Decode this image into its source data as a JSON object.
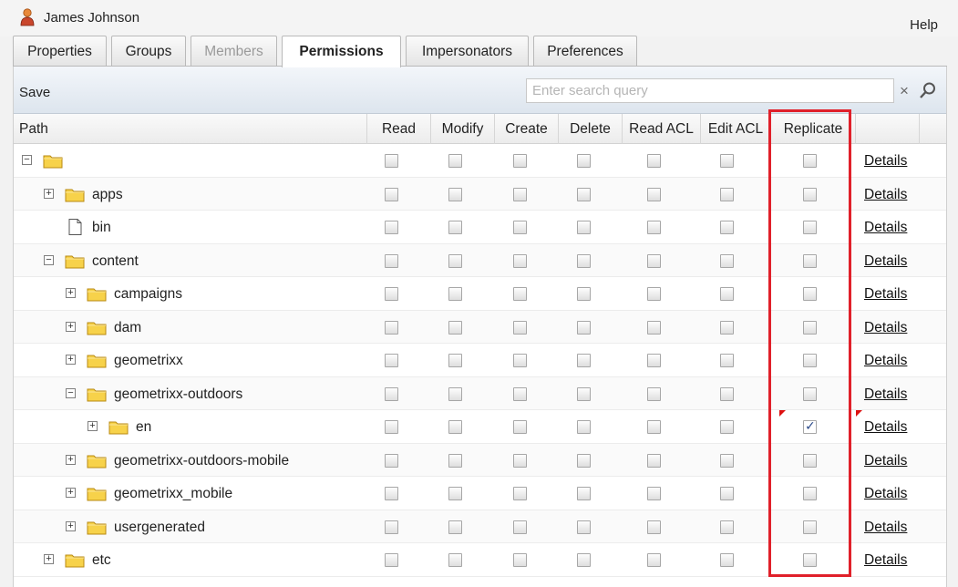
{
  "header": {
    "user_name": "James Johnson",
    "help_label": "Help"
  },
  "tabs": [
    {
      "label": "Properties",
      "state": "normal"
    },
    {
      "label": "Groups",
      "state": "normal"
    },
    {
      "label": "Members",
      "state": "disabled"
    },
    {
      "label": "Permissions",
      "state": "active"
    },
    {
      "label": "Impersonators",
      "state": "normal"
    },
    {
      "label": "Preferences",
      "state": "normal"
    }
  ],
  "toolbar": {
    "save_label": "Save",
    "search_placeholder": "Enter search query",
    "clear_label": "×"
  },
  "columns": [
    "Path",
    "Read",
    "Modify",
    "Create",
    "Delete",
    "Read ACL",
    "Edit ACL",
    "Replicate"
  ],
  "details_label": "Details",
  "rows": [
    {
      "label": "",
      "depth": 0,
      "toggle": "minus",
      "icon": "folder-icon",
      "checked": [
        false,
        false,
        false,
        false,
        false,
        false,
        false
      ],
      "dirty": false
    },
    {
      "label": "apps",
      "depth": 1,
      "toggle": "plus",
      "icon": "folder-icon",
      "checked": [
        false,
        false,
        false,
        false,
        false,
        false,
        false
      ],
      "dirty": false
    },
    {
      "label": "bin",
      "depth": 1,
      "toggle": "none",
      "icon": "file-icon",
      "checked": [
        false,
        false,
        false,
        false,
        false,
        false,
        false
      ],
      "dirty": false
    },
    {
      "label": "content",
      "depth": 1,
      "toggle": "minus",
      "icon": "folder-icon",
      "checked": [
        false,
        false,
        false,
        false,
        false,
        false,
        false
      ],
      "dirty": false
    },
    {
      "label": "campaigns",
      "depth": 2,
      "toggle": "plus",
      "icon": "folder-icon",
      "checked": [
        false,
        false,
        false,
        false,
        false,
        false,
        false
      ],
      "dirty": false
    },
    {
      "label": "dam",
      "depth": 2,
      "toggle": "plus",
      "icon": "folder-icon",
      "checked": [
        false,
        false,
        false,
        false,
        false,
        false,
        false
      ],
      "dirty": false
    },
    {
      "label": "geometrixx",
      "depth": 2,
      "toggle": "plus",
      "icon": "folder-icon",
      "checked": [
        false,
        false,
        false,
        false,
        false,
        false,
        false
      ],
      "dirty": false
    },
    {
      "label": "geometrixx-outdoors",
      "depth": 2,
      "toggle": "minus",
      "icon": "folder-icon",
      "checked": [
        false,
        false,
        false,
        false,
        false,
        false,
        false
      ],
      "dirty": false
    },
    {
      "label": "en",
      "depth": 3,
      "toggle": "plus",
      "icon": "folder-icon",
      "checked": [
        false,
        false,
        false,
        false,
        false,
        false,
        true
      ],
      "dirty": true
    },
    {
      "label": "geometrixx-outdoors-mobile",
      "depth": 2,
      "toggle": "plus",
      "icon": "folder-icon",
      "checked": [
        false,
        false,
        false,
        false,
        false,
        false,
        false
      ],
      "dirty": false
    },
    {
      "label": "geometrixx_mobile",
      "depth": 2,
      "toggle": "plus",
      "icon": "folder-icon",
      "checked": [
        false,
        false,
        false,
        false,
        false,
        false,
        false
      ],
      "dirty": false
    },
    {
      "label": "usergenerated",
      "depth": 2,
      "toggle": "plus",
      "icon": "folder-icon",
      "checked": [
        false,
        false,
        false,
        false,
        false,
        false,
        false
      ],
      "dirty": false
    },
    {
      "label": "etc",
      "depth": 1,
      "toggle": "plus",
      "icon": "folder-icon",
      "checked": [
        false,
        false,
        false,
        false,
        false,
        false,
        false
      ],
      "dirty": false
    }
  ],
  "colors": {
    "highlight": "#e0202a",
    "folder": "#f7d24a",
    "dirty_marker": "#dd1111"
  }
}
